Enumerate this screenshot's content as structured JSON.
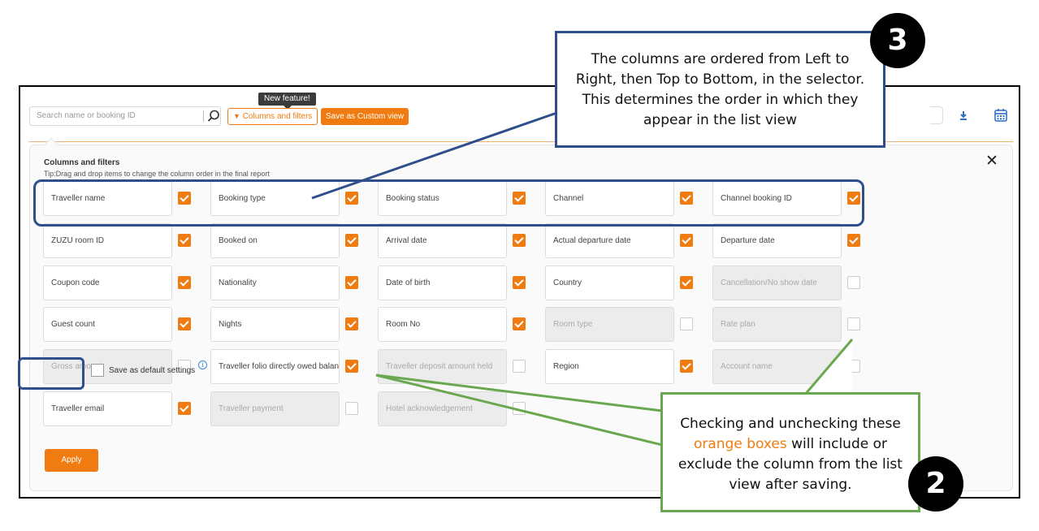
{
  "toolbar": {
    "search_placeholder": "Search name or booking ID",
    "new_feature_badge": "New feature!",
    "columns_filters_label": "Columns and filters",
    "save_custom_view_label": "Save as Custom view"
  },
  "panel": {
    "title": "Columns and filters",
    "tip": "Tip:Drag and drop items to change the column order in the final report",
    "columns": [
      {
        "label": "Traveller name",
        "checked": true
      },
      {
        "label": "Booking type",
        "checked": true
      },
      {
        "label": "Booking status",
        "checked": true
      },
      {
        "label": "Channel",
        "checked": true
      },
      {
        "label": "Channel booking ID",
        "checked": true
      },
      {
        "label": "ZUZU room ID",
        "checked": true
      },
      {
        "label": "Booked on",
        "checked": true
      },
      {
        "label": "Arrival date",
        "checked": true
      },
      {
        "label": "Actual departure date",
        "checked": true
      },
      {
        "label": "Departure date",
        "checked": true
      },
      {
        "label": "Coupon code",
        "checked": true
      },
      {
        "label": "Nationality",
        "checked": true
      },
      {
        "label": "Date of birth",
        "checked": true
      },
      {
        "label": "Country",
        "checked": true
      },
      {
        "label": "Cancellation/No show date",
        "checked": false
      },
      {
        "label": "Guest count",
        "checked": true
      },
      {
        "label": "Nights",
        "checked": true
      },
      {
        "label": "Room No",
        "checked": true
      },
      {
        "label": "Room type",
        "checked": false
      },
      {
        "label": "Rate plan",
        "checked": false
      },
      {
        "label": "Gross amount",
        "checked": false
      },
      {
        "label": "Traveller folio directly owed balan",
        "checked": true
      },
      {
        "label": "Traveller deposit amount held",
        "checked": false
      },
      {
        "label": "Region",
        "checked": true
      },
      {
        "label": "Account name",
        "checked": false
      },
      {
        "label": "Traveller email",
        "checked": true
      },
      {
        "label": "Traveller payment",
        "checked": false
      },
      {
        "label": "Hotel acknowledgement",
        "checked": false
      }
    ],
    "apply_label": "Apply",
    "default_settings_label": "Save as default settings",
    "info_glyph": "i"
  },
  "annotations": {
    "step3_number": "3",
    "step3_text": "The columns are ordered from Left to Right, then Top to Bottom, in the selector. This determines the order in which they appear in the list view",
    "step2_number": "2",
    "step2_text_before": "Checking and unchecking these ",
    "step2_text_highlight": "orange boxes",
    "step2_text_after": " will include or exclude the column from the list view after saving."
  },
  "colors": {
    "accent_orange": "#f07b10",
    "callout_blue": "#2e4f8b",
    "callout_green": "#6aa84f"
  }
}
